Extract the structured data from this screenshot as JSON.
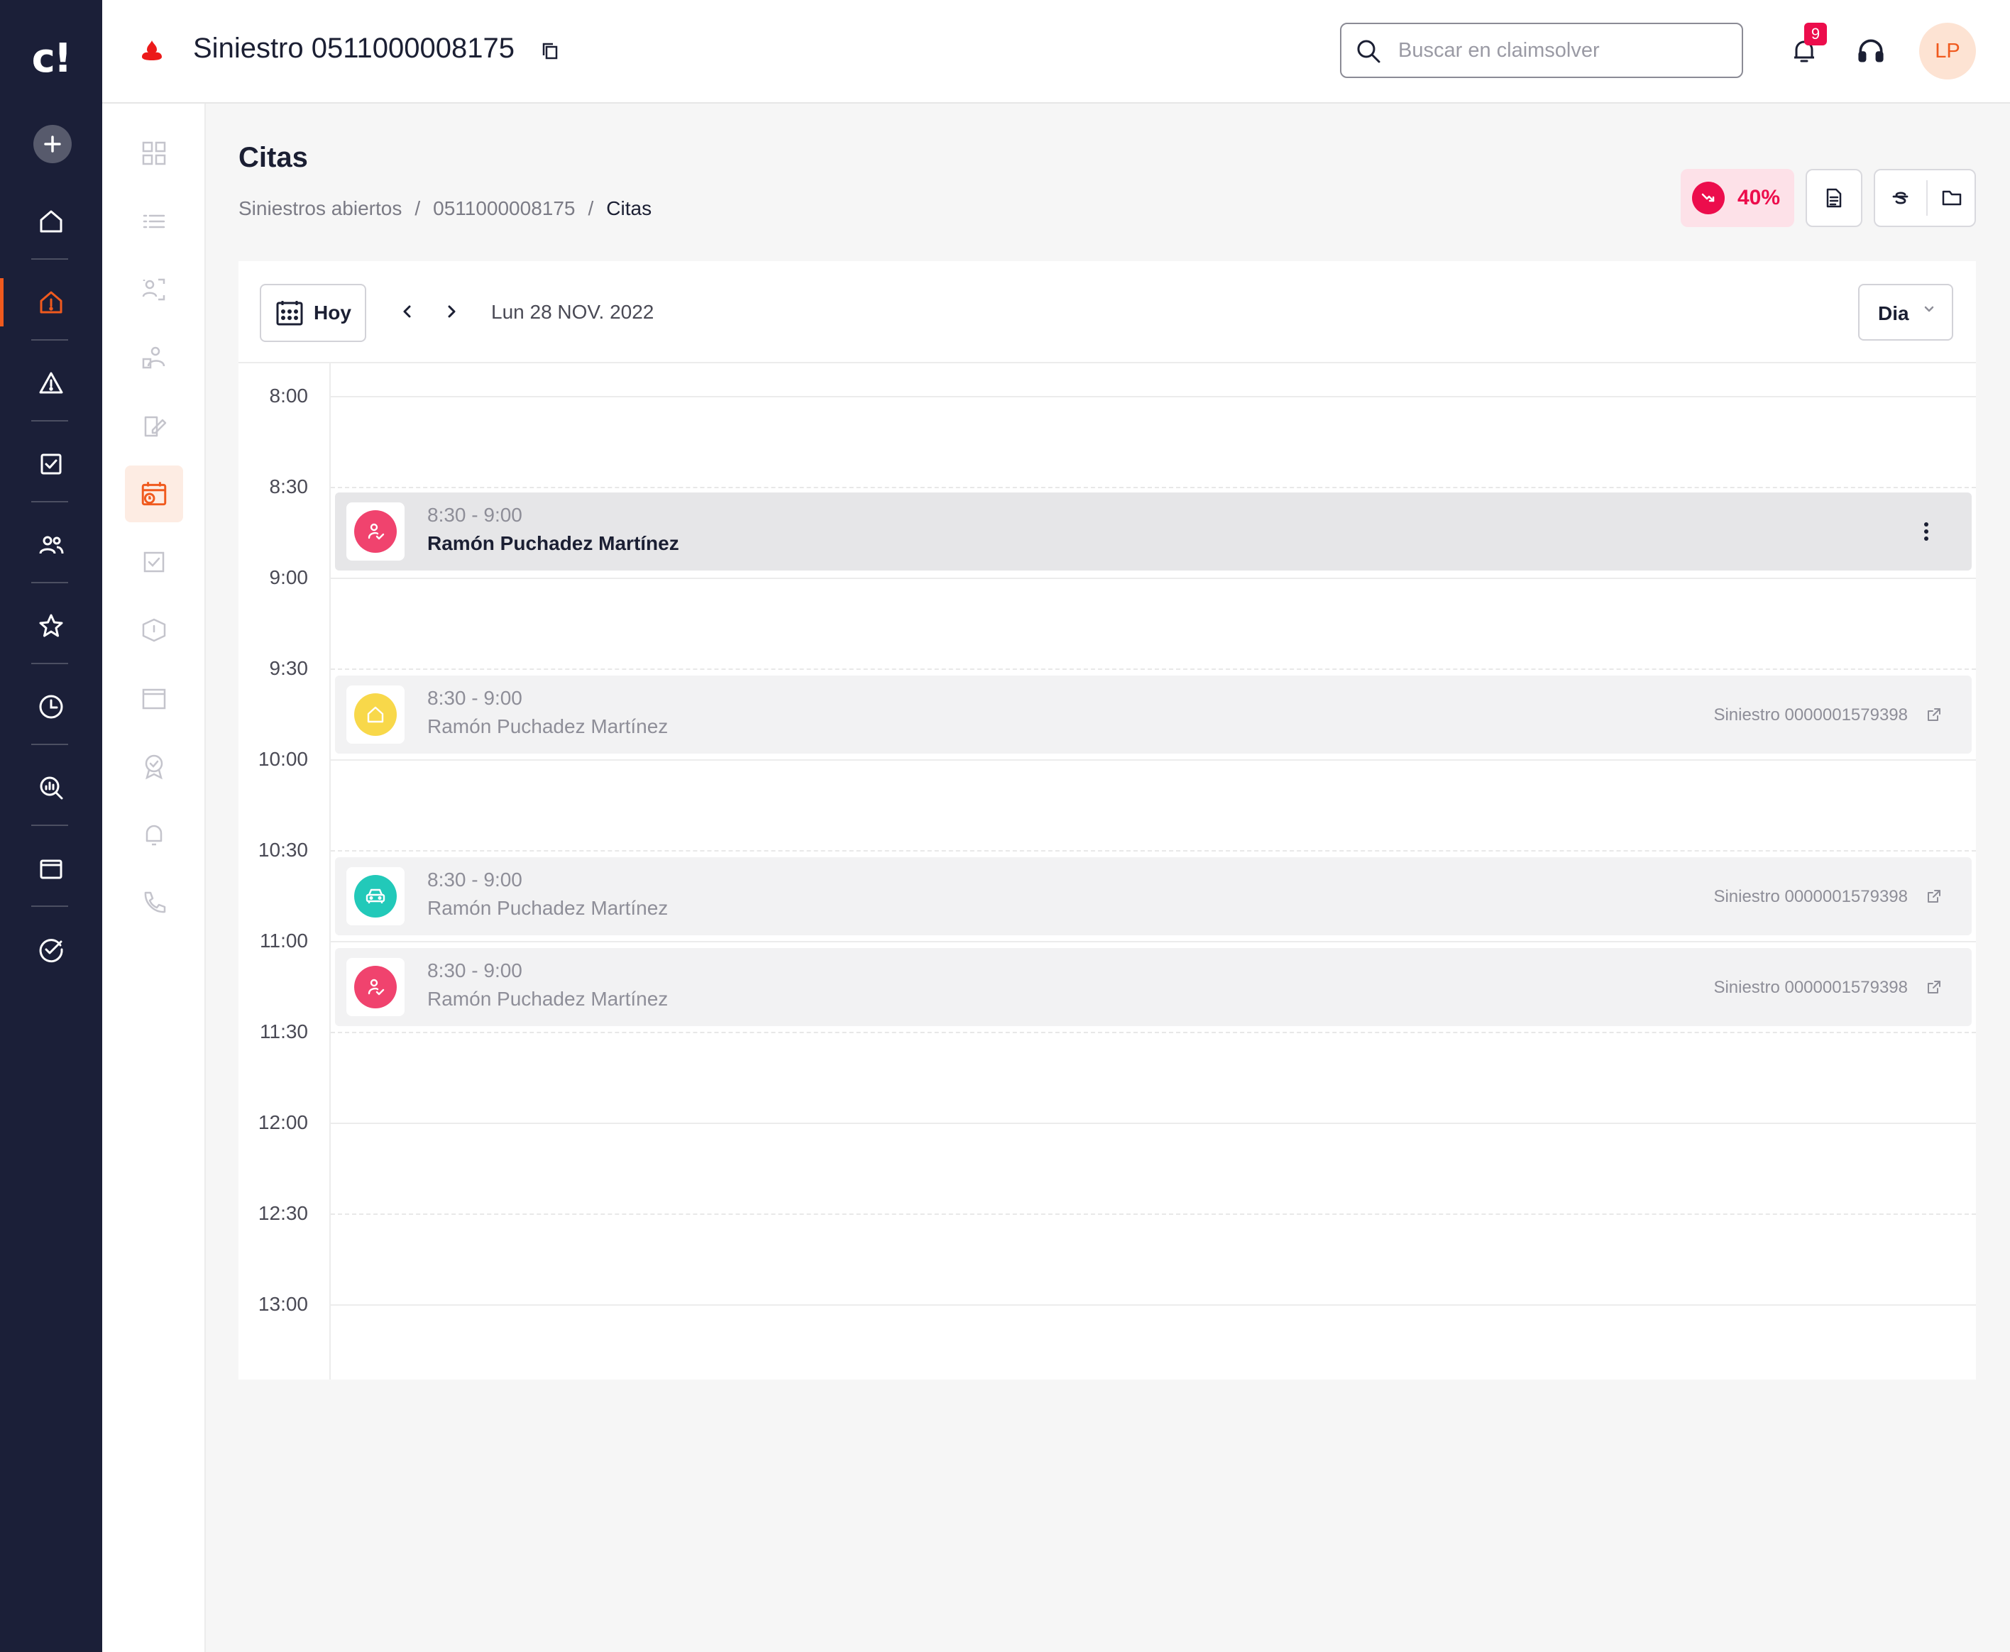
{
  "app": {
    "logo_text": "c!",
    "brand": "claimsolver"
  },
  "header": {
    "claim_title": "Siniestro 0511000008175",
    "search_placeholder": "Buscar en claimsolver",
    "notifications_count": "9",
    "user_initials": "LP"
  },
  "page": {
    "title": "Citas",
    "breadcrumb": [
      "Siniestros abiertos",
      "0511000008175",
      "Citas"
    ],
    "progress_label": "40%"
  },
  "calendar": {
    "today_label": "Hoy",
    "date_label": "Lun 28 NOV. 2022",
    "view_label": "Dia",
    "times": [
      "8:00",
      "8:30",
      "9:00",
      "9:30",
      "10:00",
      "10:30",
      "11:00",
      "11:30",
      "12:00",
      "12:30",
      "13:00"
    ],
    "events": [
      {
        "time": "8:30 - 9:00",
        "name": "Ramón Puchadez Martínez",
        "type_icon": "user-check-icon",
        "color": "#f0436e",
        "claim": "",
        "active": true
      },
      {
        "time": "8:30 - 9:00",
        "name": "Ramón Puchadez Martínez",
        "type_icon": "home-icon",
        "color": "#f8d84a",
        "claim": "Siniestro 0000001579398",
        "active": false
      },
      {
        "time": "8:30 - 9:00",
        "name": "Ramón Puchadez Martínez",
        "type_icon": "car-icon",
        "color": "#22c9b9",
        "claim": "Siniestro 0000001579398",
        "active": false
      },
      {
        "time": "8:30 - 9:00",
        "name": "Ramón Puchadez Martínez",
        "type_icon": "user-check-icon",
        "color": "#f0436e",
        "claim": "Siniestro 0000001579398",
        "active": false
      }
    ]
  },
  "colors": {
    "sidebar_bg": "#1b1f38",
    "accent": "#f05a1e",
    "alert": "#ec0d4c"
  }
}
